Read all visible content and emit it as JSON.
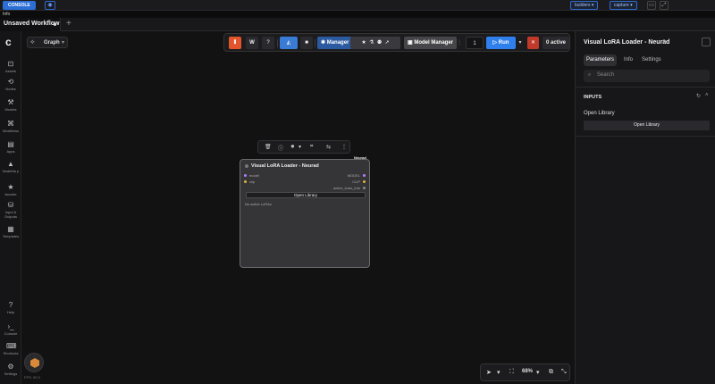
{
  "sysbar": {
    "console_label": "CONSOLE",
    "builders_label": "builders",
    "capture_label": "capture"
  },
  "infobar": {
    "label": "Info"
  },
  "tabs": [
    {
      "title": "Unsaved Workflow",
      "modified": true
    }
  ],
  "sidebar": {
    "items": [
      {
        "icon": "assets-icon",
        "label": "Assets"
      },
      {
        "icon": "nodes-icon",
        "label": "Nodes"
      },
      {
        "icon": "models-icon",
        "label": "Models"
      },
      {
        "icon": "workflows-icon",
        "label": "Workflows"
      },
      {
        "icon": "apps-icon",
        "label": "Apps"
      },
      {
        "icon": "nodemap-icon",
        "label": "NodeMa p"
      },
      {
        "icon": "favorite-icon",
        "label": "favorite"
      },
      {
        "icon": "input-outputs-icon",
        "label": "Input & Outputs"
      },
      {
        "icon": "templates-icon",
        "label": "Templates"
      }
    ],
    "bottom_items": [
      {
        "icon": "help-icon",
        "label": "Help"
      },
      {
        "icon": "console-icon",
        "label": "Console"
      },
      {
        "icon": "shortcuts-icon",
        "label": "Shortcuts"
      },
      {
        "icon": "settings-icon",
        "label": "Settings"
      }
    ],
    "version": "FPS: 50.0"
  },
  "graph_mode": {
    "label": "Graph"
  },
  "toolbar": {
    "manager_label": "Manager",
    "model_manager_label": "Model Manager",
    "queue_count": "1",
    "run_label": "Run",
    "active_label": "0 active",
    "help_label": "?"
  },
  "node": {
    "tag": "Neurad",
    "title": "Visual LoRA Loader - Neurad",
    "inputs": [
      "model",
      "clip"
    ],
    "outputs": [
      "MODEL",
      "CLIP",
      "active_loras_info"
    ],
    "button_label": "Open Library",
    "note": "No active LoRAs"
  },
  "canvas": {
    "zoom": "68%"
  },
  "panel": {
    "title": "Visual LoRA Loader - Neurad",
    "tabs": [
      "Parameters",
      "Info",
      "Settings"
    ],
    "active_tab": 0,
    "search_placeholder": "Search",
    "section_label": "INPUTS",
    "open_library_label": "Open Library",
    "open_library_button": "Open Library"
  },
  "colors": {
    "accent_blue": "#2f80ed",
    "orange": "#e2542b",
    "danger": "#c0392b",
    "pin_yellow": "#e3b341"
  }
}
